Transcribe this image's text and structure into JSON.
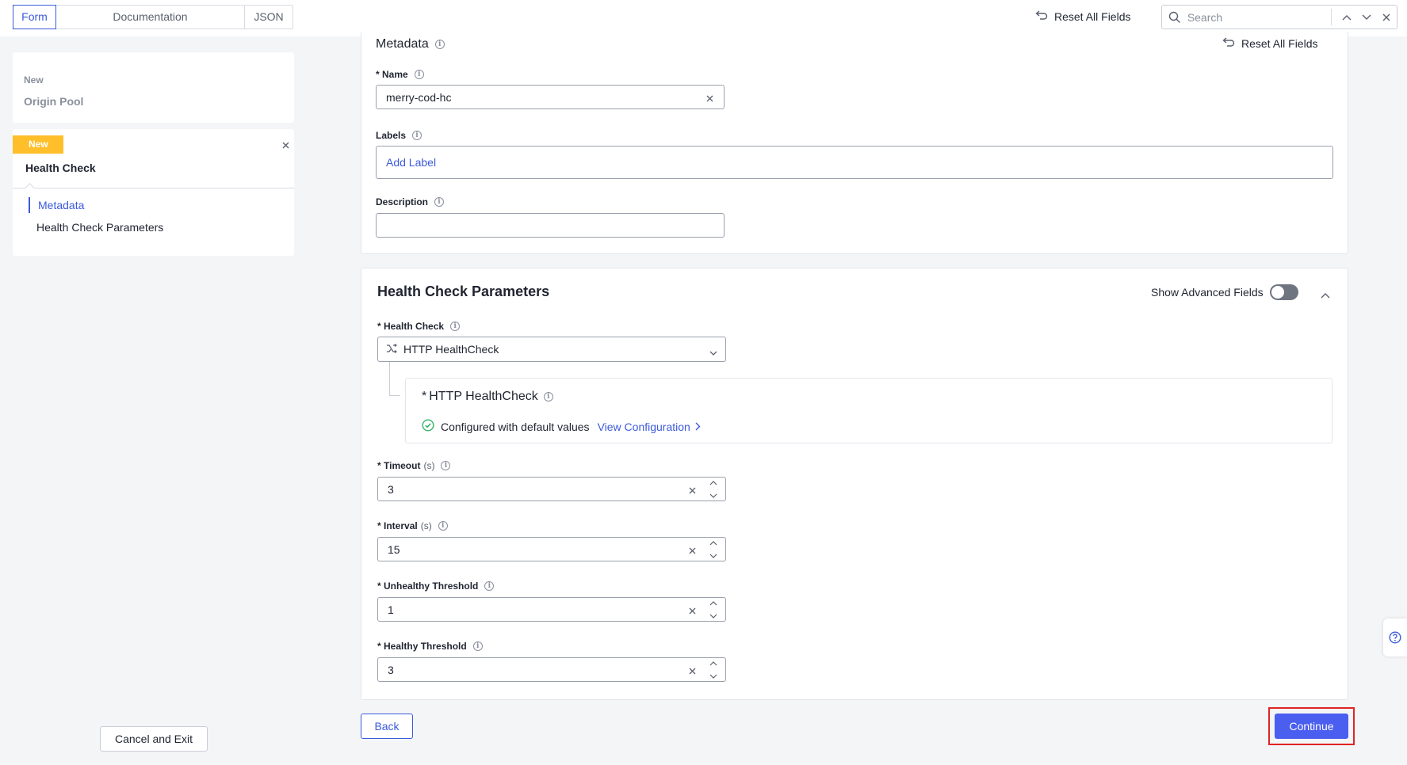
{
  "topbar": {
    "tabs": [
      {
        "label": "Form",
        "active": true
      },
      {
        "label": "Documentation",
        "active": false
      },
      {
        "label": "JSON",
        "active": false
      }
    ],
    "reset_label": "Reset All Fields",
    "search_placeholder": "Search"
  },
  "sidebar": {
    "origin_card": {
      "status": "New",
      "title": "Origin Pool"
    },
    "hc_card": {
      "badge": "New",
      "title": "Health Check",
      "nav": [
        {
          "label": "Metadata",
          "active": true
        },
        {
          "label": "Health Check Parameters",
          "active": false
        }
      ]
    },
    "cancel_label": "Cancel and Exit"
  },
  "metadata": {
    "title": "Metadata",
    "reset_label": "Reset All Fields",
    "name_label": "Name",
    "name_value": "merry-cod-hc",
    "labels_label": "Labels",
    "add_label": "Add Label",
    "description_label": "Description",
    "description_value": ""
  },
  "hc_params": {
    "title": "Health Check Parameters",
    "advanced_label": "Show Advanced Fields",
    "advanced_on": false,
    "health_check_label": "Health Check",
    "health_check_value": "HTTP HealthCheck",
    "sub_title": "HTTP HealthCheck",
    "sub_status": "Configured with default values",
    "view_config": "View Configuration",
    "timeout": {
      "label": "Timeout",
      "unit": "(s)",
      "value": "3"
    },
    "interval": {
      "label": "Interval",
      "unit": "(s)",
      "value": "15"
    },
    "unhealthy": {
      "label": "Unhealthy Threshold",
      "value": "1"
    },
    "healthy": {
      "label": "Healthy Threshold",
      "value": "3"
    }
  },
  "footer": {
    "back_label": "Back",
    "continue_label": "Continue"
  },
  "colors": {
    "accent": "#3b5bdb",
    "primary_button": "#4a5ef0",
    "badge": "#ffbf2b",
    "success": "#2fb366",
    "highlight_outline": "#e02424"
  }
}
